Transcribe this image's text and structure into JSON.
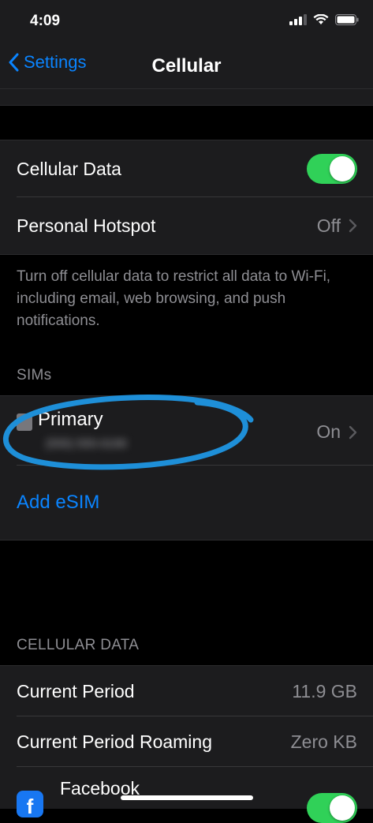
{
  "status_bar": {
    "time": "4:09",
    "icons": [
      "cellular-signal-icon",
      "wifi-icon",
      "battery-icon"
    ]
  },
  "nav": {
    "back_label": "Settings",
    "title": "Cellular"
  },
  "main_group": {
    "cellular_data_label": "Cellular Data",
    "cellular_data_on": true,
    "hotspot_label": "Personal Hotspot",
    "hotspot_value": "Off"
  },
  "footer": {
    "text": "Turn off cellular data to restrict all data to Wi-Fi, including email, web browsing, and push notifications."
  },
  "sims": {
    "header": "SIMs",
    "primary_label": "Primary",
    "primary_number": "(555) 555-0199",
    "primary_status": "On",
    "add_esim_label": "Add eSIM"
  },
  "cellular_data_section": {
    "header": "CELLULAR DATA",
    "current_period_label": "Current Period",
    "current_period_value": "11.9 GB",
    "roaming_label": "Current Period Roaming",
    "roaming_value": "Zero KB",
    "app_label": "Facebook",
    "app_toggle_on": true
  },
  "colors": {
    "accent": "#0a84ff",
    "toggle_on": "#30d158",
    "annotation": "#1e8fd8"
  }
}
